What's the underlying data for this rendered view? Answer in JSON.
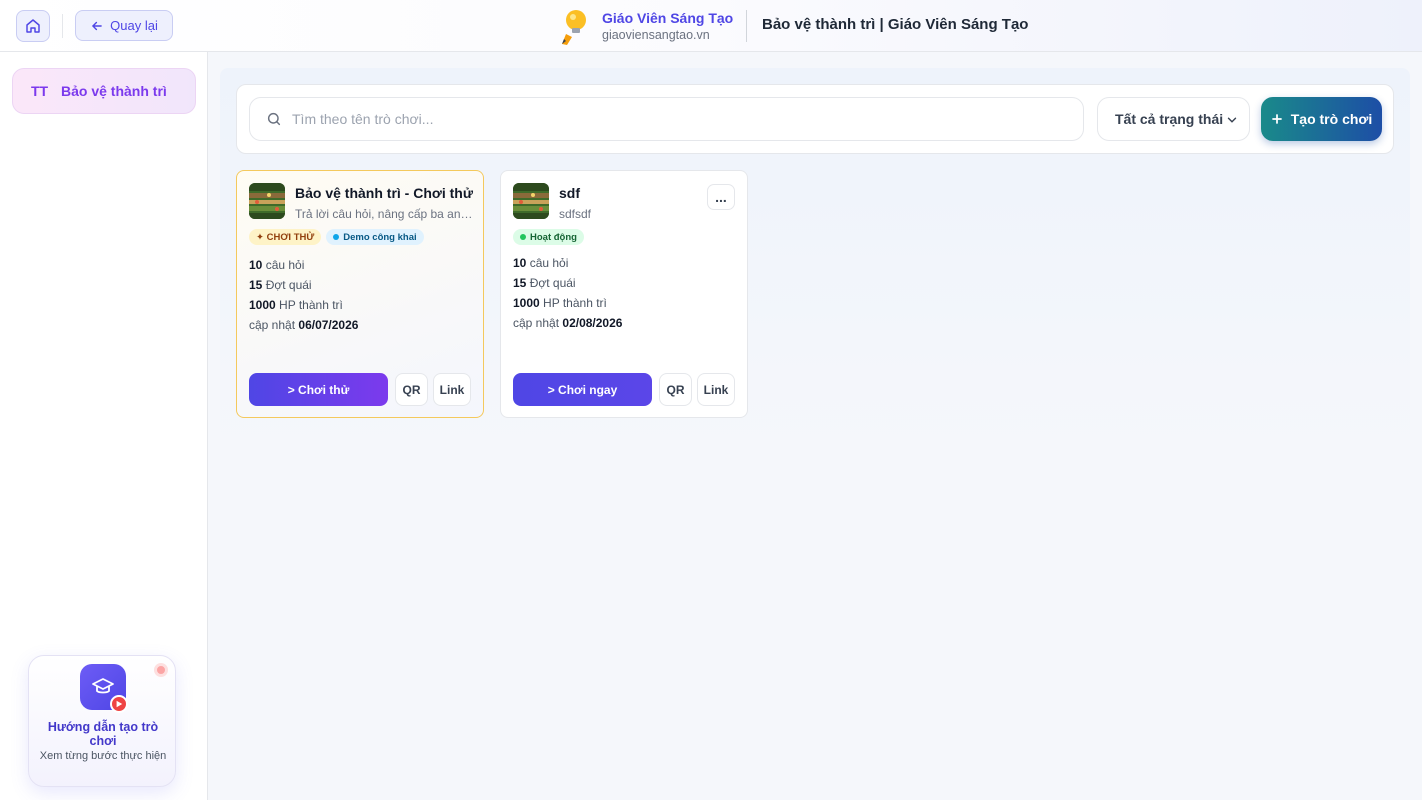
{
  "header": {
    "back_label": "Quay lại",
    "brand_name": "Giáo Viên Sáng Tạo",
    "brand_site": "giaoviensangtao.vn",
    "page_title": "Bảo vệ thành trì | Giáo Viên Sáng Tạo"
  },
  "sidebar": {
    "items": [
      {
        "abbr": "TT",
        "label": "Bảo vệ thành trì"
      }
    ],
    "guide": {
      "title": "Hướng dẫn tạo trò chơi",
      "subtitle": "Xem từng bước thực hiện"
    }
  },
  "toolbar": {
    "search_placeholder": "Tìm theo tên trò chơi...",
    "status_filter": "Tất cả trạng thái",
    "create_label": "Tạo trò chơi"
  },
  "games": [
    {
      "title": "Bảo vệ thành trì - Chơi thử",
      "description": "Trả lời câu hỏi, nâng cấp ba anh hùng và bảo vệ thành trì",
      "badges": [
        "✦ CHƠI THỬ",
        "Demo công khai"
      ],
      "questions_count": "10",
      "questions_label": "câu hỏi",
      "waves_count": "15",
      "waves_label": "Đợt quái",
      "hp_count": "1000",
      "hp_label": "HP thành trì",
      "updated_label": "cập nhật",
      "updated_date": "06/07/2026",
      "play_label": "> Chơi thử",
      "qr_label": "QR",
      "link_label": "Link"
    },
    {
      "title": "sdf",
      "description": "sdfsdf",
      "menu_label": "...",
      "badges": [
        "Hoạt động"
      ],
      "questions_count": "10",
      "questions_label": "câu hỏi",
      "waves_count": "15",
      "waves_label": "Đợt quái",
      "hp_count": "1000",
      "hp_label": "HP thành trì",
      "updated_label": "cập nhật",
      "updated_date": "02/08/2026",
      "play_label": "> Chơi ngay",
      "qr_label": "QR",
      "link_label": "Link"
    }
  ],
  "colors": {
    "accent": "#4f46e5",
    "purple": "#7c3aed",
    "create_start": "#1a8a8a",
    "create_end": "#1d4ea6",
    "active_green": "#22c55e",
    "public_blue": "#0ea5e9",
    "demo_border": "#f4c95d"
  }
}
